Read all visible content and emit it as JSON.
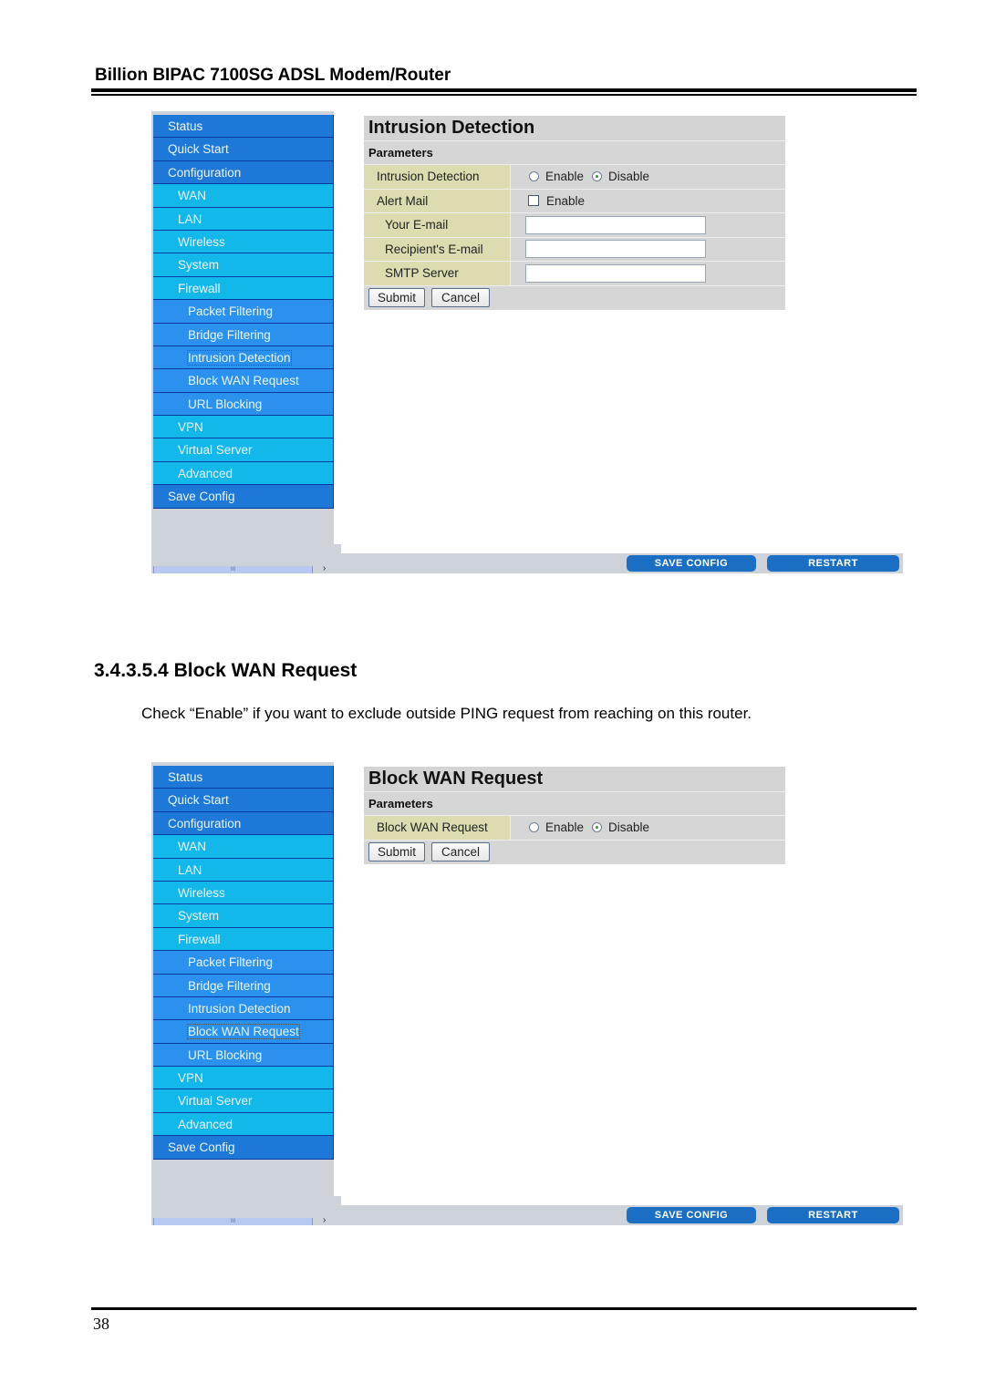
{
  "document": {
    "header": "Billion BIPAC 7100SG ADSL Modem/Router",
    "section_title": "3.4.3.5.4 Block WAN Request",
    "section_body": "Check “Enable” if you want to exclude outside PING request from reaching on this router.",
    "page_number": "38"
  },
  "sidebar": {
    "items": [
      {
        "label": "Status",
        "level": 0
      },
      {
        "label": "Quick Start",
        "level": 0
      },
      {
        "label": "Configuration",
        "level": 0
      },
      {
        "label": "WAN",
        "level": 1
      },
      {
        "label": "LAN",
        "level": 1
      },
      {
        "label": "Wireless",
        "level": 1
      },
      {
        "label": "System",
        "level": 1
      },
      {
        "label": "Firewall",
        "level": 1
      },
      {
        "label": "Packet Filtering",
        "level": 2
      },
      {
        "label": "Bridge Filtering",
        "level": 2
      },
      {
        "label": "Intrusion Detection",
        "level": 2
      },
      {
        "label": "Block WAN Request",
        "level": 2
      },
      {
        "label": "URL Blocking",
        "level": 2
      },
      {
        "label": "VPN",
        "level": 1
      },
      {
        "label": "Virtual Server",
        "level": 1
      },
      {
        "label": "Advanced",
        "level": 1
      },
      {
        "label": "Save Config",
        "level": 0
      }
    ],
    "scroll_grip": "III",
    "scroll_arrow": "›"
  },
  "bottom_bar": {
    "save_config": "SAVE CONFIG",
    "restart": "RESTART"
  },
  "screenshot1": {
    "selected_menu": "Intrusion Detection",
    "title": "Intrusion Detection",
    "subtitle": "Parameters",
    "rows": {
      "intrusion_detection": {
        "label": "Intrusion Detection",
        "enable": "Enable",
        "disable": "Disable",
        "value": "Disable"
      },
      "alert_mail": {
        "label": "Alert Mail",
        "checkbox_label": "Enable",
        "checked": false
      },
      "your_email": {
        "label": "Your E-mail",
        "value": ""
      },
      "recipient_email": {
        "label": "Recipient's E-mail",
        "value": ""
      },
      "smtp_server": {
        "label": "SMTP Server",
        "value": ""
      }
    },
    "submit": "Submit",
    "cancel": "Cancel"
  },
  "screenshot2": {
    "selected_menu": "Block WAN Request",
    "title": "Block WAN Request",
    "subtitle": "Parameters",
    "rows": {
      "block_wan_request": {
        "label": "Block WAN Request",
        "enable": "Enable",
        "disable": "Disable",
        "value": "Disable"
      }
    },
    "submit": "Submit",
    "cancel": "Cancel"
  },
  "colors": {
    "menu_top_level": "#1e78d8",
    "menu_second_level": "#12b8ea",
    "menu_third_level": "#2a92ee",
    "label_cell": "#dcdcb0",
    "panel_bg": "#d6d6d6",
    "bar_button": "#1a6fc4"
  }
}
